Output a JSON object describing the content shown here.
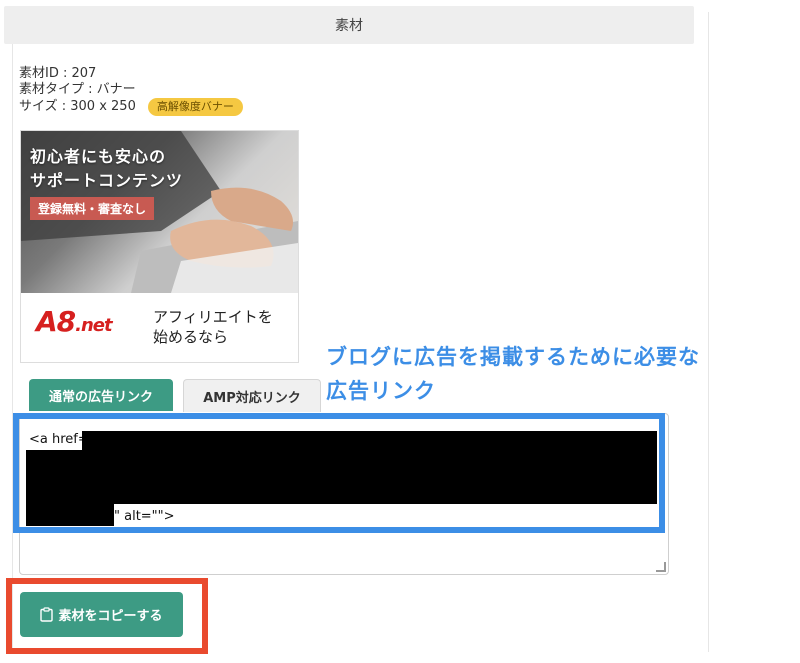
{
  "panel": {
    "title": "素材"
  },
  "material": {
    "id_label": "素材ID : 207",
    "type_label": "素材タイプ : バナー",
    "size_label": "サイズ : 300 x 250",
    "badge": "高解像度バナー"
  },
  "banner": {
    "line1": "初心者にも安心の",
    "line2": "サポートコンテンツ",
    "tag": "登録無料・審査なし",
    "logo_main": "A8",
    "logo_sub": ".net",
    "cta_line1": "アフィリエイトを",
    "cta_line2": "始めるなら"
  },
  "tabs": [
    {
      "label": "通常の広告リンク",
      "active": true
    },
    {
      "label": "AMP対応リンク",
      "active": false
    }
  ],
  "code": {
    "start": "<a href=",
    "end": "\" alt=\"\">"
  },
  "annotation": {
    "line1": "ブログに広告を掲載するために必要な",
    "line2": "広告リンク"
  },
  "copy_button": {
    "label": "素材をコピーする",
    "icon": "clipboard-icon"
  },
  "colors": {
    "accent": "#3d9b84",
    "badge": "#f5c842",
    "highlight_blue": "#3c8ee6",
    "highlight_red": "#e94a2e",
    "tag": "#c85a52",
    "logo_red": "#d6201f"
  }
}
